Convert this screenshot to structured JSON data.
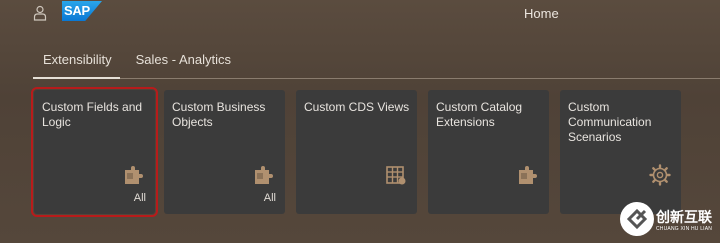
{
  "shell": {
    "title": "Home",
    "logo_text": "SAP",
    "user_icon": "user-icon"
  },
  "tabs": [
    {
      "label": "Extensibility",
      "active": true
    },
    {
      "label": "Sales - Analytics",
      "active": false
    }
  ],
  "tiles": [
    {
      "title": "Custom Fields and Logic",
      "icon": "puzzle-icon",
      "info": "All",
      "selected": true
    },
    {
      "title": "Custom Business Objects",
      "icon": "puzzle-icon",
      "info": "All",
      "selected": false
    },
    {
      "title": "Custom CDS Views",
      "icon": "calendar-grid-icon",
      "info": "",
      "selected": false
    },
    {
      "title": "Custom Catalog Extensions",
      "icon": "puzzle-icon",
      "info": "",
      "selected": false
    },
    {
      "title": "Custom Communication Scenarios",
      "icon": "gear-icon",
      "info": "",
      "selected": false
    }
  ],
  "watermark": {
    "text": "创新互联",
    "sub": "CHUANG XIN HU LIAN"
  },
  "colors": {
    "background": "#55473b",
    "tile": "#3b3b3b",
    "icon": "#b0906f",
    "selection": "#b81b1b"
  }
}
